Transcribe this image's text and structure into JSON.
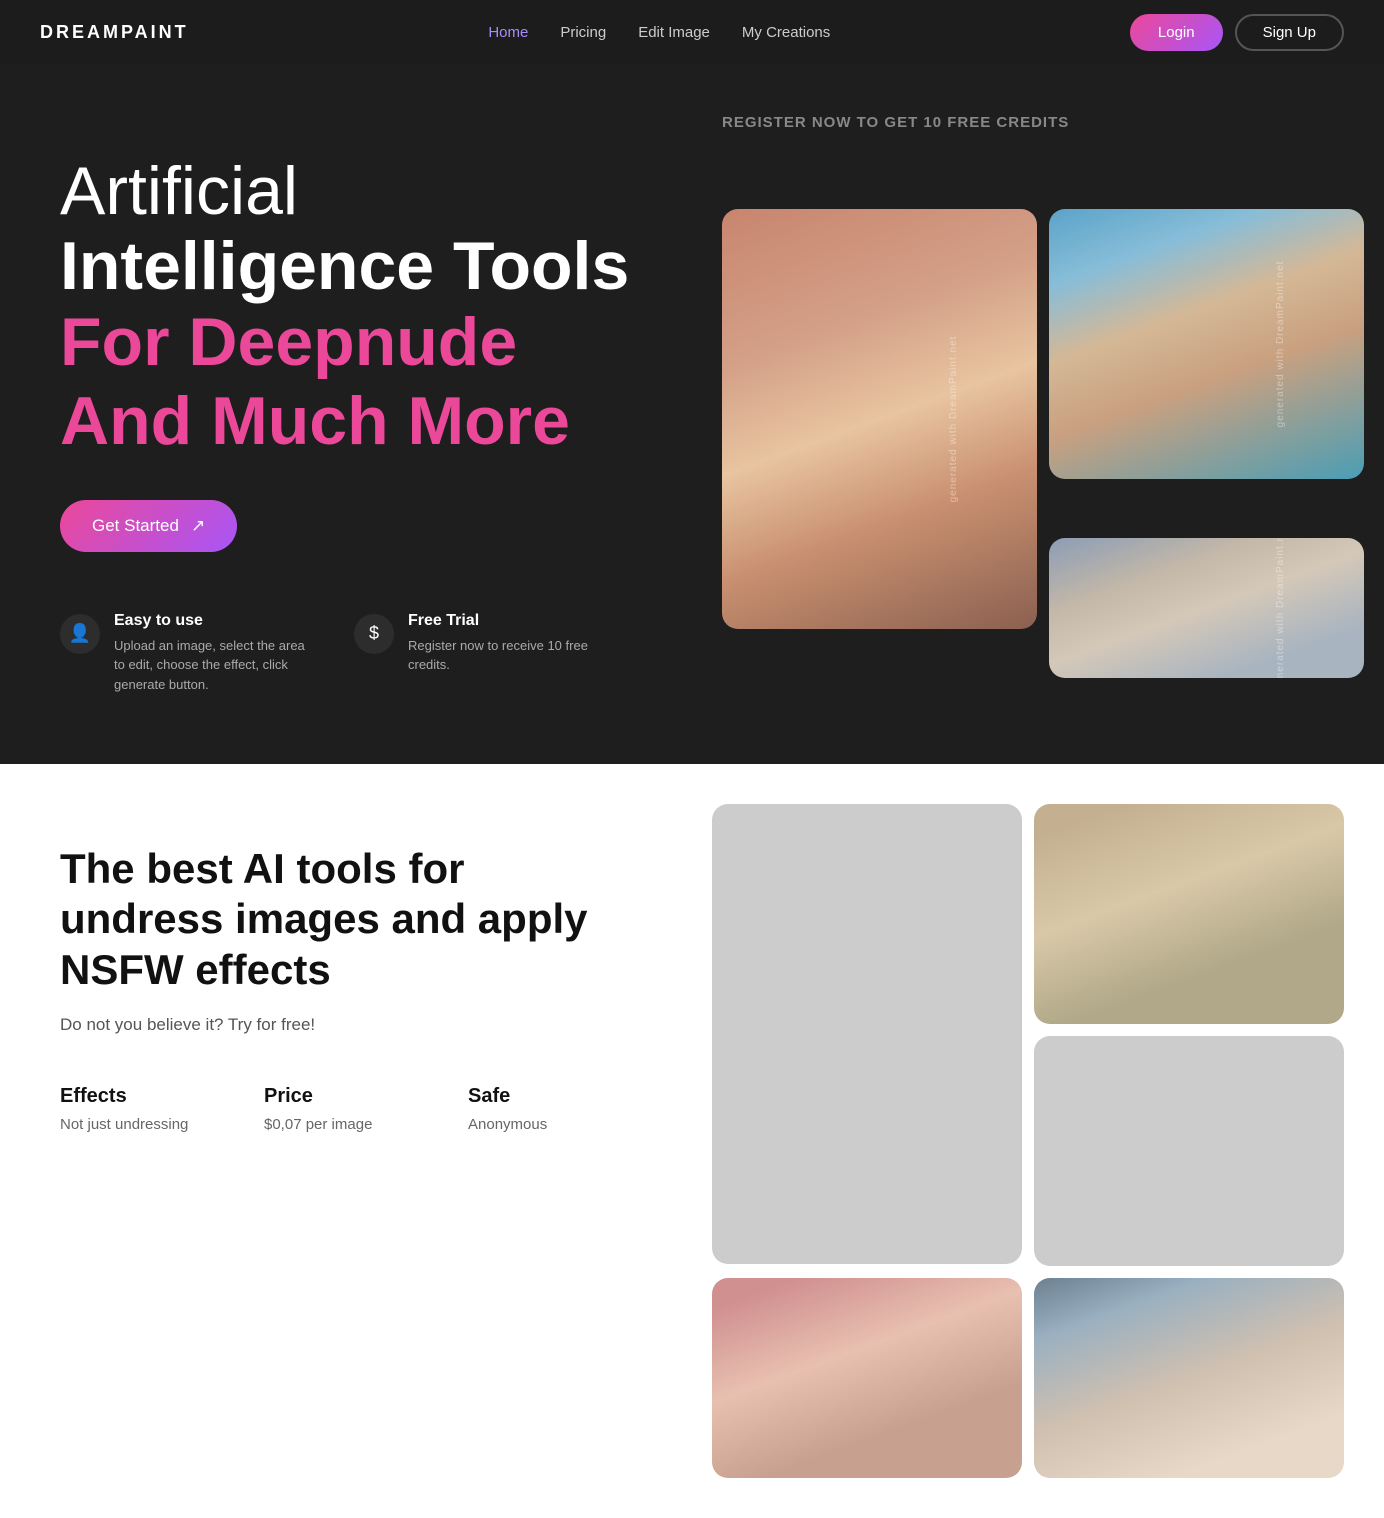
{
  "nav": {
    "logo": "DREAMPAINT",
    "links": [
      {
        "id": "home",
        "label": "Home",
        "active": true
      },
      {
        "id": "pricing",
        "label": "Pricing",
        "active": false
      },
      {
        "id": "edit-image",
        "label": "Edit Image",
        "active": false
      },
      {
        "id": "my-creations",
        "label": "My Creations",
        "active": false
      }
    ],
    "login_label": "Login",
    "signup_label": "Sign Up"
  },
  "hero": {
    "title_line1": "Artificial",
    "title_line2": "Intelligence Tools",
    "title_pink": "For Deepnude And Much More",
    "cta_label": "Get Started",
    "register_banner": "REGISTER NOW TO GET 10 FREE CREDITS",
    "features": [
      {
        "id": "easy",
        "icon": "👤",
        "title": "Easy to use",
        "desc": "Upload an image, select the area to edit, choose the effect, click generate button."
      },
      {
        "id": "free-trial",
        "icon": "$",
        "title": "Free Trial",
        "desc": "Register now to receive 10 free credits."
      }
    ],
    "images": [
      {
        "id": "redhead",
        "class": "img-redhead",
        "height": "h-270",
        "watermark": "generated with DreamPaint.net",
        "span": "tall"
      },
      {
        "id": "girl-blue",
        "class": "img-girl-blue",
        "height": "h-270",
        "watermark": "generated with DreamPaint.net",
        "span": "normal"
      },
      {
        "id": "girl-right",
        "class": "img-girl-right",
        "height": "h-270",
        "watermark": "generated with DreamPaint.net",
        "span": "normal"
      }
    ]
  },
  "section2": {
    "title": "The best AI tools for undress images and apply NSFW effects",
    "subtitle": "Do not you believe it? Try for free!",
    "stats": [
      {
        "label": "Effects",
        "value": "Not just undressing"
      },
      {
        "label": "Price",
        "value": "$0,07 per image"
      },
      {
        "label": "Safe",
        "value": "Anonymous"
      }
    ],
    "images": [
      {
        "id": "girl-white",
        "class": "img-girl-white",
        "height": "h2-280",
        "span": "tall"
      },
      {
        "id": "girl-living",
        "class": "img-living",
        "height": "h2-220"
      },
      {
        "id": "girl-face",
        "class": "img-girl-face",
        "height": "h2-180"
      },
      {
        "id": "girl-bow",
        "class": "img-bow",
        "height": "h2-280"
      }
    ]
  }
}
